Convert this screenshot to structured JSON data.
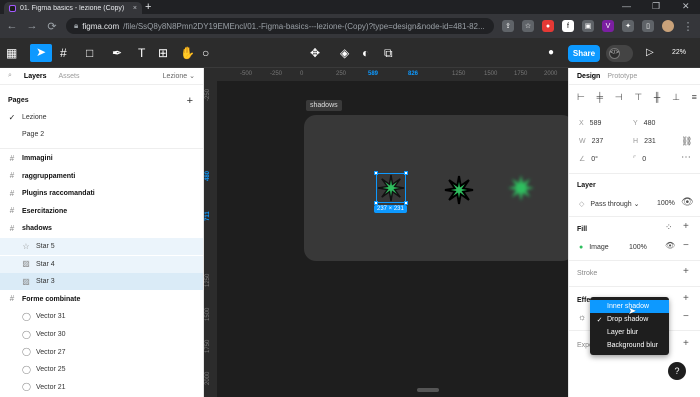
{
  "browser": {
    "tab_title": "01. Figma basics - lezione (Copy)",
    "tab_close": "×",
    "new_tab": "+",
    "url_host": "figma.com",
    "url_path": "/file/SsQ8y8N8Pmn2DY19EMEncl/01.-Figma-basics---lezione-(Copy)?type=design&node-id=481-82...",
    "back": "←",
    "forward": "→",
    "reload": "⟳",
    "window_min": "—",
    "window_max": "❐",
    "window_close": "✕"
  },
  "toolbar": {
    "share_label": "Share",
    "zoom_label": "22%",
    "play": "▷"
  },
  "left_panel": {
    "tab_layers": "Layers",
    "tab_assets": "Assets",
    "page_switch": "Lezione",
    "pages_heading": "Pages",
    "add_page": "+",
    "pages": [
      {
        "label": "Lezione",
        "current": true
      },
      {
        "label": "Page 2",
        "current": false
      }
    ],
    "layers": [
      {
        "label": "Immagini",
        "indent": 0,
        "bold": true,
        "icon": "frame"
      },
      {
        "label": "raggruppamenti",
        "indent": 0,
        "bold": true,
        "icon": "frame"
      },
      {
        "label": "Plugins raccomandati",
        "indent": 0,
        "bold": true,
        "icon": "frame"
      },
      {
        "label": "Esercitazione",
        "indent": 0,
        "bold": true,
        "icon": "frame"
      },
      {
        "label": "shadows",
        "indent": 0,
        "bold": true,
        "icon": "frame"
      },
      {
        "label": "Star 5",
        "indent": 1,
        "bold": false,
        "icon": "star"
      },
      {
        "label": "Star 4",
        "indent": 1,
        "bold": false,
        "icon": "image"
      },
      {
        "label": "Star 3",
        "indent": 1,
        "bold": false,
        "icon": "image",
        "selected": true
      },
      {
        "label": "Forme combinate",
        "indent": 0,
        "bold": true,
        "icon": "frame"
      },
      {
        "label": "Vector 31",
        "indent": 1,
        "bold": false,
        "icon": "vector"
      },
      {
        "label": "Vector 30",
        "indent": 1,
        "bold": false,
        "icon": "vector"
      },
      {
        "label": "Vector 27",
        "indent": 1,
        "bold": false,
        "icon": "vector"
      },
      {
        "label": "Vector 25",
        "indent": 1,
        "bold": false,
        "icon": "vector"
      },
      {
        "label": "Vector 21",
        "indent": 1,
        "bold": false,
        "icon": "vector"
      }
    ]
  },
  "canvas": {
    "frame_label": "shadows",
    "size_badge": "237 × 231",
    "ruler_top": [
      "-500",
      "-250",
      "0",
      "250",
      "589",
      "826",
      "1250",
      "1500",
      "1750",
      "2000"
    ],
    "ruler_top_highlight": [
      "589",
      "826"
    ],
    "ruler_left": [
      "-250",
      "480",
      "711",
      "1250",
      "1500",
      "1750",
      "2000"
    ],
    "ruler_left_highlight": [
      "480",
      "711"
    ]
  },
  "right_panel": {
    "tab_design": "Design",
    "tab_prototype": "Prototype",
    "x_label": "X",
    "x_value": "589",
    "y_label": "Y",
    "y_value": "480",
    "w_label": "W",
    "w_value": "237",
    "h_label": "H",
    "h_value": "231",
    "rotation": "0°",
    "radius": "0",
    "layer_heading": "Layer",
    "blend_mode": "Pass through",
    "layer_opacity": "100%",
    "fill_heading": "Fill",
    "fill_type": "Image",
    "fill_opacity": "100%",
    "stroke_heading": "Stroke",
    "effects_heading": "Effe",
    "export_heading": "Expo",
    "add": "+",
    "remove": "−"
  },
  "effects_menu": {
    "items": [
      {
        "label": "Inner shadow",
        "checked": false,
        "hovered": true
      },
      {
        "label": "Drop shadow",
        "checked": true,
        "hovered": false
      },
      {
        "label": "Layer blur",
        "checked": false,
        "hovered": false
      },
      {
        "label": "Background blur",
        "checked": false,
        "hovered": false
      }
    ]
  },
  "help": "?",
  "colors": {
    "accent": "#0d99ff",
    "star_green": "#2fbf5f",
    "canvas_bg": "#1e1e1e",
    "frame_bg": "#383838"
  }
}
